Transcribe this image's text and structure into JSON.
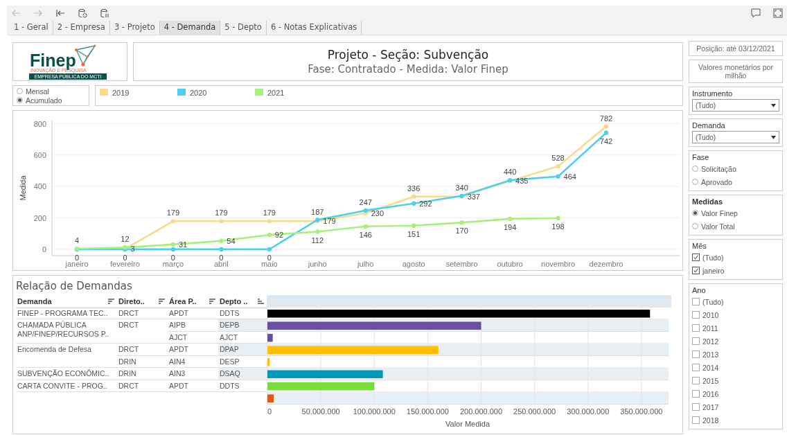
{
  "tabs": [
    {
      "label": "1 - Geral",
      "selected": false
    },
    {
      "label": "2 - Empresa",
      "selected": false
    },
    {
      "label": "3 - Projeto",
      "selected": false
    },
    {
      "label": "4 - Demanda",
      "selected": true
    },
    {
      "label": "5 - Depto",
      "selected": false
    },
    {
      "label": "6 - Notas Explicativas",
      "selected": false
    }
  ],
  "logo": {
    "name": "Finep",
    "tagline": "INOVAÇÃO E PESQUISA",
    "footer": "EMPRESA PÚBLICA DO MCTI"
  },
  "header": {
    "title": "Projeto - Seção: Subvenção",
    "subtitle": "Fase:  Contratado - Medida: Valor Finep"
  },
  "period_options": [
    {
      "label": "Mensal",
      "selected": false
    },
    {
      "label": "Acumulado",
      "selected": true
    }
  ],
  "line_chart": {
    "chart_data": {
      "type": "line",
      "ylabel": "Medida",
      "categories": [
        "janeiro",
        "fevereiro",
        "março",
        "abril",
        "maio",
        "junho",
        "julho",
        "agosto",
        "setembro",
        "outubro",
        "novembro",
        "dezembro"
      ],
      "series": [
        {
          "name": "2019",
          "color": "#fadb8a",
          "marker": "circle",
          "values": [
            null,
            3,
            179,
            179,
            179,
            179,
            230,
            336,
            337,
            435,
            528,
            782
          ]
        },
        {
          "name": "2020",
          "color": "#4fcfed",
          "marker": "circle",
          "values": [
            0,
            0,
            0,
            0,
            0,
            187,
            247,
            292,
            340,
            440,
            464,
            742
          ]
        },
        {
          "name": "2021",
          "color": "#a9f07a",
          "marker": "circle",
          "values": [
            4,
            12,
            31,
            54,
            92,
            112,
            146,
            151,
            170,
            194,
            198,
            null
          ]
        }
      ],
      "ylim": [
        -40,
        820
      ],
      "yticks": [
        0,
        200,
        400,
        600,
        800
      ],
      "grid": true,
      "data_labels": true
    }
  },
  "demandas": {
    "title": "Relação de Demandas",
    "columns": [
      "Demanda",
      "Direto..",
      "Área P..",
      "Depto .."
    ],
    "groups": [
      {
        "demanda": "FINEP - PROGRAMA TEC..",
        "lines": [
          {
            "diretoria": "DRCT",
            "area": "APDT",
            "depto": "DDTS"
          }
        ]
      },
      {
        "demanda": "CHAMADA PÚBLICA ANP/FINEP/RECURSOS P..",
        "lines": [
          {
            "diretoria": "DRCT",
            "area": "AIPB",
            "depto": "DEPB"
          },
          {
            "area": "AJCT",
            "depto": "AJCT"
          }
        ]
      },
      {
        "demanda": "Encomenda de Defesa",
        "lines": [
          {
            "diretoria": "DRCT",
            "area": "APDT",
            "depto": "DPAP"
          },
          {
            "diretoria": "DRIN",
            "area": "AIN4",
            "depto": "DESP"
          }
        ]
      },
      {
        "demanda": "SUBVENÇÃO ECONÔMIC..",
        "lines": [
          {
            "diretoria": "DRIN",
            "area": "AIN3",
            "depto": "DSAQ"
          }
        ]
      },
      {
        "demanda": "CARTA CONVITE - PROG..",
        "lines": [
          {
            "diretoria": "DRCT",
            "area": "APDT",
            "depto": "DDTS"
          }
        ]
      }
    ],
    "chart_data": {
      "type": "bar",
      "orientation": "horizontal",
      "xlabel": "Valor Medida",
      "values": [
        358000000,
        200000000,
        5000000,
        160000000,
        2000000,
        108000000,
        100000000,
        6000000
      ],
      "colors": [
        "#000000",
        "#6a4fa0",
        "#6a4fa0",
        "#ffbf00",
        "#ffbf00",
        "#0097b8",
        "#77dd3a",
        "#e0581a"
      ],
      "xlim": [
        0,
        376000000
      ],
      "grid": true,
      "xticks": [
        {
          "value": 0,
          "label": "0"
        },
        {
          "value": 50000000,
          "label": "50.000.000"
        },
        {
          "value": 100000000,
          "label": "100.000.000"
        },
        {
          "value": 150000000,
          "label": "150.000.000"
        },
        {
          "value": 200000000,
          "label": "200.000.000"
        },
        {
          "value": 250000000,
          "label": "250.000.000"
        },
        {
          "value": 300000000,
          "label": "300.000.000"
        },
        {
          "value": 350000000,
          "label": "350.000.000"
        }
      ]
    }
  },
  "sidebar": {
    "position": "Posição: até 03/12/2021",
    "units_note": "Valores monetários por milhão",
    "filters": [
      {
        "kind": "dropdown",
        "title": "Instrumento",
        "value": "(Tudo)"
      },
      {
        "kind": "dropdown",
        "title": "Demanda",
        "value": "(Tudo)"
      },
      {
        "kind": "radio",
        "title": "Fase",
        "options": [
          {
            "label": "Solicitação",
            "selected": false
          },
          {
            "label": "Aprovado",
            "selected": false
          }
        ]
      },
      {
        "kind": "radio",
        "title": "Medidas",
        "bold": true,
        "options": [
          {
            "label": "Valor Finep",
            "selected": true
          },
          {
            "label": "Valor Total",
            "selected": false
          }
        ]
      },
      {
        "kind": "checkbox",
        "title": "Mês",
        "options": [
          {
            "label": "(Tudo)",
            "checked": true
          },
          {
            "label": "janeiro",
            "checked": true
          }
        ]
      },
      {
        "kind": "checkbox",
        "title": "Ano",
        "options": [
          {
            "label": "(Tudo)",
            "checked": false
          },
          {
            "label": "2010",
            "checked": false
          },
          {
            "label": "2011",
            "checked": false
          },
          {
            "label": "2012",
            "checked": false
          },
          {
            "label": "2013",
            "checked": false
          },
          {
            "label": "2014",
            "checked": false
          },
          {
            "label": "2015",
            "checked": false
          },
          {
            "label": "2016",
            "checked": false
          },
          {
            "label": "2017",
            "checked": false
          },
          {
            "label": "2018",
            "checked": false
          }
        ]
      }
    ]
  }
}
